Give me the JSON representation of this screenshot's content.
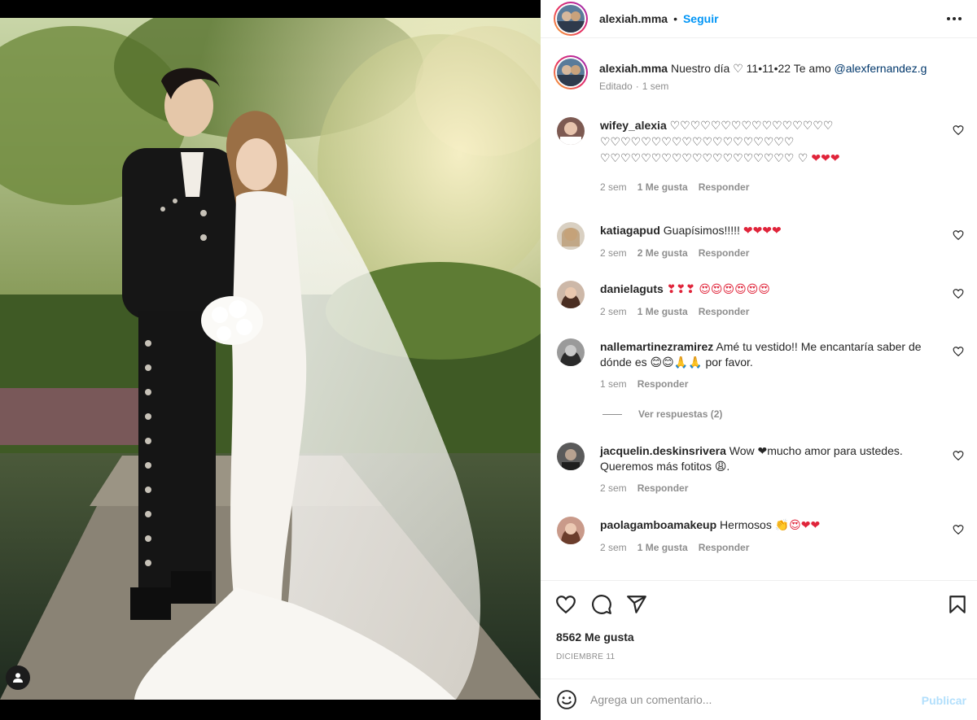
{
  "post": {
    "username": "alexiah.mma",
    "dot": "•",
    "follow_label": "Seguir",
    "caption_text": "Nuestro día ♡ 11•11•22 Te amo",
    "caption_mention": "@alexfernandez.g",
    "edited_label": "Editado",
    "edited_time": "1 sem"
  },
  "comments": [
    {
      "user": "wifey_alexia",
      "text": "♡♡♡♡♡♡♡♡♡♡♡♡♡♡♡♡ ♡♡♡♡♡♡♡♡♡♡♡♡♡♡♡♡♡♡♡ ♡♡♡♡♡♡♡♡♡♡♡♡♡♡♡♡♡♡♡ ♡",
      "emoji": "❤❤❤",
      "time": "2 sem",
      "likes": "1 Me gusta",
      "reply": "Responder"
    },
    {
      "user": "katiagapud",
      "text": "Guapísimos!!!!!",
      "emoji": "❤❤❤❤",
      "time": "2 sem",
      "likes": "2 Me gusta",
      "reply": "Responder"
    },
    {
      "user": "danielaguts",
      "text": "",
      "emoji": "❣❣❣ 😍😍😍😍😍😍",
      "time": "2 sem",
      "likes": "1 Me gusta",
      "reply": "Responder"
    },
    {
      "user": "nallemartinezramirez",
      "text": "Amé tu vestido!! Me encantaría saber de dónde es 😊😊🙏🙏 por favor.",
      "emoji": "",
      "time": "1 sem",
      "likes": "",
      "reply": "Responder"
    },
    {
      "user": "jacquelin.deskinsrivera",
      "text": "Wow ❤mucho amor para ustedes. Queremos más fotitos 😩.",
      "emoji": "",
      "time": "2 sem",
      "likes": "",
      "reply": "Responder"
    },
    {
      "user": "paolagamboamakeup",
      "text": "Hermosos",
      "emoji": "👏😍❤❤",
      "time": "2 sem",
      "likes": "1 Me gusta",
      "reply": "Responder"
    }
  ],
  "view_replies": "Ver respuestas (2)",
  "footer": {
    "likes": "8562 Me gusta",
    "date": "DICIEMBRE 11",
    "comment_placeholder": "Agrega un comentario...",
    "publish_label": "Publicar"
  },
  "icons": {
    "more": "more-options-icon",
    "like": "heart-icon",
    "comment": "comment-icon",
    "share": "share-icon",
    "save": "bookmark-icon",
    "emoji": "emoji-icon",
    "tag": "user-tag-icon"
  },
  "colors": {
    "accent": "#0095f6",
    "publish_disabled": "#b2dffc",
    "heart_red": "#e0243a",
    "muted": "#8e8e8e"
  }
}
